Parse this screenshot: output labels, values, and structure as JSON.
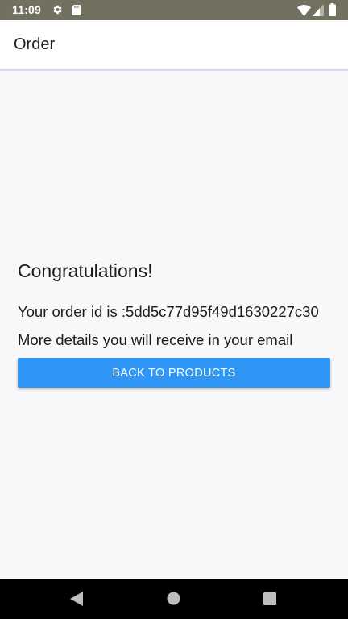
{
  "status_bar": {
    "time": "11:09",
    "icons": [
      "settings-gear-icon",
      "sd-card-icon",
      "wifi-icon",
      "cell-signal-icon",
      "battery-icon"
    ]
  },
  "app_bar": {
    "title": "Order"
  },
  "content": {
    "heading": "Congratulations!",
    "order_line": "Your order id is :5dd5c77d95f49d1630227c30",
    "details_line": "More details you will receive in your email",
    "back_button_label": "BACK TO PRODUCTS"
  },
  "nav_bar": {
    "icons": [
      "back-icon",
      "home-icon",
      "recents-icon"
    ]
  },
  "colors": {
    "status_bar": "#72715f",
    "accent_button": "#2f96f5",
    "background": "#f8f8fb",
    "divider": "#d9d8ee"
  }
}
